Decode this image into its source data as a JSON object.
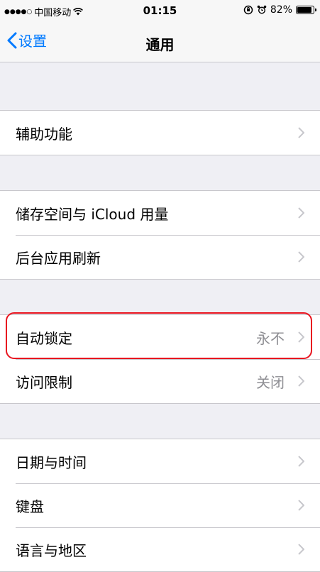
{
  "status_bar": {
    "signal": "●●●●○",
    "carrier": "中国移动",
    "wifi_icon": "wifi-icon",
    "time": "01:15",
    "battery": "82%",
    "battery_level": 0.82
  },
  "nav": {
    "back_label": "设置",
    "title": "通用"
  },
  "groups": [
    {
      "items": [
        {
          "label": "辅助功能",
          "detail": ""
        }
      ]
    },
    {
      "items": [
        {
          "label": "储存空间与 iCloud 用量",
          "detail": ""
        },
        {
          "label": "后台应用刷新",
          "detail": ""
        }
      ]
    },
    {
      "items": [
        {
          "label": "自动锁定",
          "detail": "永不"
        },
        {
          "label": "访问限制",
          "detail": "关闭"
        }
      ]
    },
    {
      "items": [
        {
          "label": "日期与时间",
          "detail": ""
        },
        {
          "label": "键盘",
          "detail": ""
        },
        {
          "label": "语言与地区",
          "detail": ""
        }
      ]
    }
  ],
  "colors": {
    "accent": "#007aff",
    "highlight": "#e8141f",
    "background": "#efeff4",
    "detail": "#8e8e93"
  }
}
